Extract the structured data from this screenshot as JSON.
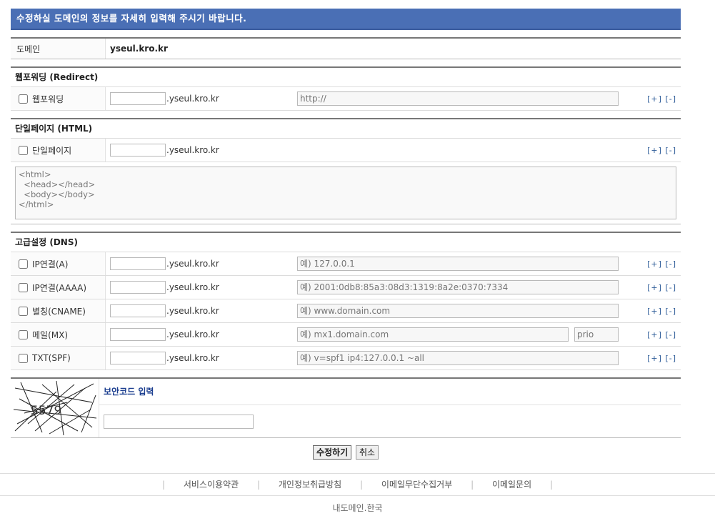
{
  "banner": "수정하실 도메인의 정보를 자세히 입력해 주시기 바랍니다.",
  "domain": {
    "label": "도메인",
    "value": "yseul.kro.kr"
  },
  "redirect": {
    "title": "웹포워딩 (Redirect)",
    "checkbox_label": "웹포워딩",
    "suffix": ".yseul.kro.kr",
    "placeholder": "http://",
    "plus": "[+]",
    "minus": "[-]"
  },
  "html": {
    "title": "단일페이지 (HTML)",
    "checkbox_label": "단일페이지",
    "suffix": ".yseul.kro.kr",
    "content": "<html>\n  <head></head>\n  <body></body>\n</html>",
    "plus": "[+]",
    "minus": "[-]"
  },
  "dns": {
    "title": "고급설정 (DNS)",
    "rows": [
      {
        "label": "IP연결(A)",
        "suffix": ".yseul.kro.kr",
        "placeholder": "예) 127.0.0.1"
      },
      {
        "label": "IP연결(AAAA)",
        "suffix": ".yseul.kro.kr",
        "placeholder": "예) 2001:0db8:85a3:08d3:1319:8a2e:0370:7334"
      },
      {
        "label": "별칭(CNAME)",
        "suffix": ".yseul.kro.kr",
        "placeholder": "예) www.domain.com"
      },
      {
        "label": "메일(MX)",
        "suffix": ".yseul.kro.kr",
        "placeholder": "예) mx1.domain.com",
        "prio_placeholder": "prio"
      },
      {
        "label": "TXT(SPF)",
        "suffix": ".yseul.kro.kr",
        "placeholder": "예) v=spf1 ip4:127.0.0.1 ~all"
      }
    ],
    "plus": "[+]",
    "minus": "[-]"
  },
  "captcha": {
    "title": "보안코드 입력",
    "code": "5579"
  },
  "buttons": {
    "submit": "수정하기",
    "cancel": "취소"
  },
  "footer": {
    "links": [
      "서비스이용약관",
      "개인정보취급방침",
      "이메일무단수집거부",
      "이메일문의"
    ],
    "separator": "|",
    "copyright": "내도메인.한국"
  }
}
